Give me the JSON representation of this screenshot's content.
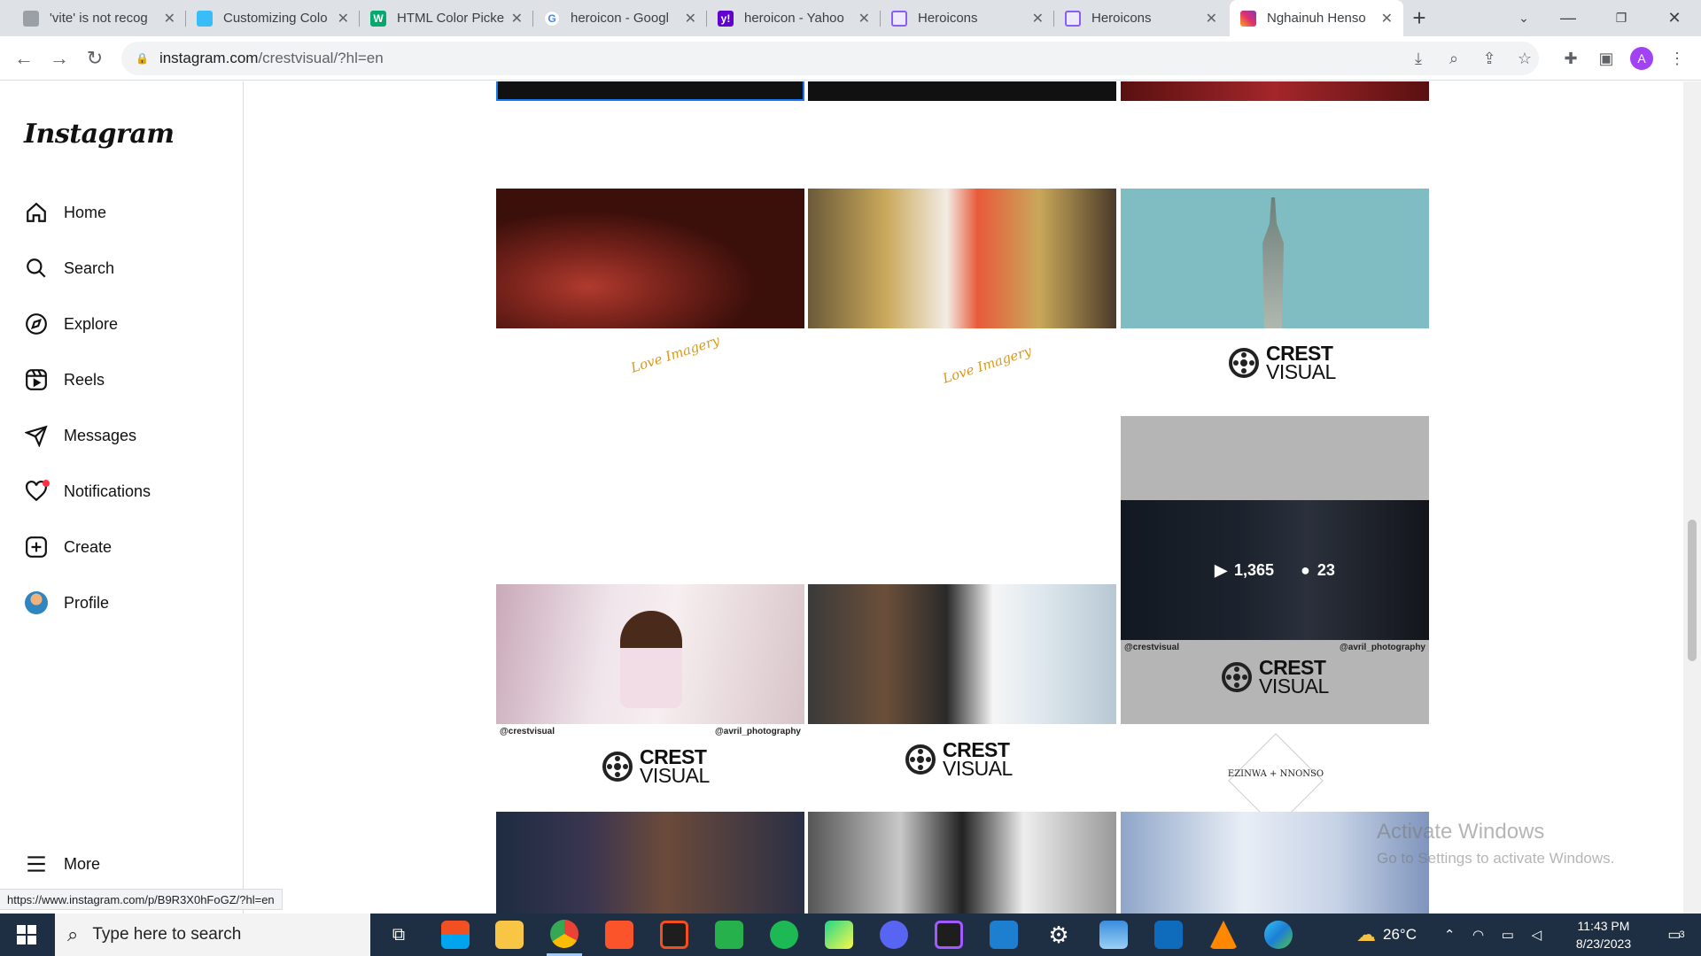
{
  "browser": {
    "tabs": [
      {
        "title": "'vite' is not recog",
        "favicon": "doc-icon",
        "color": "#5f6368"
      },
      {
        "title": "Customizing Colo",
        "favicon": "tailwind-icon",
        "color": "#38bdf8"
      },
      {
        "title": "HTML Color Picke",
        "favicon": "w3schools-icon",
        "color": "#04aa6d"
      },
      {
        "title": "heroicon - Googl",
        "favicon": "google-icon",
        "color": "#4285f4"
      },
      {
        "title": "heroicon - Yahoo",
        "favicon": "yahoo-icon",
        "color": "#6001d2"
      },
      {
        "title": "Heroicons",
        "favicon": "heroicons-icon",
        "color": "#8b5cf6"
      },
      {
        "title": "Heroicons",
        "favicon": "heroicons-icon",
        "color": "#8b5cf6"
      },
      {
        "title": "Nghainuh Henso",
        "favicon": "instagram-icon",
        "color": "#e1306c"
      }
    ],
    "url_host": "instagram.com",
    "url_path": "/crestvisual/?hl=en",
    "profile_initial": "A",
    "status_url": "https://www.instagram.com/p/B9R3X0hFoGZ/?hl=en"
  },
  "sidebar": {
    "logo": "Instagram",
    "items": [
      {
        "label": "Home",
        "icon": "home-icon"
      },
      {
        "label": "Search",
        "icon": "search-icon"
      },
      {
        "label": "Explore",
        "icon": "compass-icon"
      },
      {
        "label": "Reels",
        "icon": "reels-icon"
      },
      {
        "label": "Messages",
        "icon": "send-icon"
      },
      {
        "label": "Notifications",
        "icon": "heart-icon"
      },
      {
        "label": "Create",
        "icon": "plus-square-icon"
      },
      {
        "label": "Profile",
        "icon": "avatar-icon"
      }
    ],
    "more": "More"
  },
  "posts": {
    "overlay_views": "1,365",
    "overlay_comments": "23",
    "watermark_left": "@crestvisual",
    "watermark_right": "@avril_photography",
    "crest_word1": "CREST",
    "crest_word2": "VISUAL",
    "ezinwa": "EZINWA + NNONSO",
    "love_text": "Love Imagery"
  },
  "windows_watermark": {
    "line1": "Activate Windows",
    "line2": "Go to Settings to activate Windows."
  },
  "taskbar": {
    "search_placeholder": "Type here to search",
    "weather": "26°C",
    "time": "11:43 PM",
    "date": "8/23/2023",
    "notifications": "3"
  }
}
